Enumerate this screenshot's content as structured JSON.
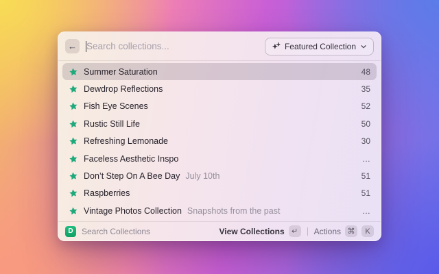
{
  "panel": {
    "header": {
      "back_icon": "←",
      "search_placeholder": "Search collections...",
      "dropdown_label": "Featured Collection"
    },
    "list": [
      {
        "title": "Summer Saturation",
        "accessory": "48",
        "selected": true
      },
      {
        "title": "Dewdrop Reflections",
        "accessory": "35"
      },
      {
        "title": "Fish Eye Scenes",
        "accessory": "52"
      },
      {
        "title": "Rustic Still Life",
        "accessory": "50"
      },
      {
        "title": "Refreshing Lemonade",
        "accessory": "30"
      },
      {
        "title": "Faceless Aesthetic Inspo",
        "accessory": "…"
      },
      {
        "title": "Don’t Step On A Bee Day",
        "subtitle": "July 10th",
        "accessory": "51"
      },
      {
        "title": "Raspberries",
        "accessory": "51"
      },
      {
        "title": "Vintage Photos Collection",
        "subtitle": "Snapshots from the past",
        "accessory": "…"
      }
    ],
    "footer": {
      "logo_letter": "D",
      "app_label": "Search Collections",
      "primary_action": "View Collections",
      "primary_key": "↵",
      "secondary_action": "Actions",
      "secondary_keys": [
        "⌘",
        "K"
      ]
    }
  },
  "colors": {
    "star_green": "#1fa97c",
    "logo_green": "#17b077",
    "selected_row": "rgba(99,84,103,0.21)",
    "bg_top_left": "#f8dc55",
    "bg_top_right": "#5b7ce8",
    "bg_bottom_left": "#f9997f",
    "bg_bottom_right": "#5a5ae9",
    "bg_center": "#c95fd6"
  }
}
